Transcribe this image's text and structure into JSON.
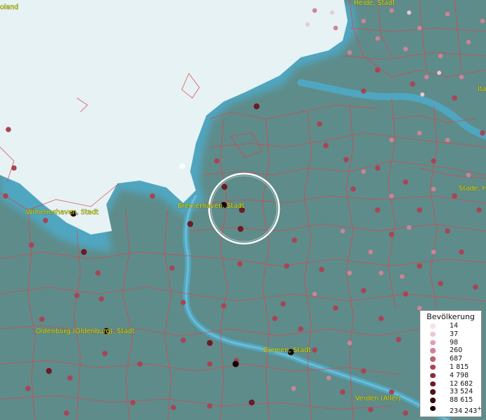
{
  "map": {
    "labels": {
      "top_left": "goland",
      "heide": "Heide, Stadt",
      "right_mid": "Stade, H",
      "right_top": "Ita",
      "bremerhaven": "Bremerhaven, Stadt",
      "wilhelmshaven": "Wilhelmshaven, Stadt",
      "oldenburg": "Oldenburg (Oldenburg), Stadt",
      "bremen": "Bremen, Stadt",
      "verden": "Verden (Aller)"
    },
    "colors": {
      "sea": "#e6f2f4",
      "land": "#5e8c8a",
      "river": "#4fa6c0",
      "border": "#e0404a",
      "label": "#e8e000",
      "highlight_ring": "#ffffff"
    },
    "selection": "ring"
  },
  "legend": {
    "title": "Bevölkerung",
    "items": [
      {
        "label": "14",
        "color": "#f6e3ea"
      },
      {
        "label": "37",
        "color": "#ecc7d2"
      },
      {
        "label": "98",
        "color": "#dda2b1"
      },
      {
        "label": "260",
        "color": "#cf8396"
      },
      {
        "label": "687",
        "color": "#bd6073"
      },
      {
        "label": "1 815",
        "color": "#a94454"
      },
      {
        "label": "4 798",
        "color": "#8c2c3a"
      },
      {
        "label": "12 682",
        "color": "#6e1a27"
      },
      {
        "label": "33 524",
        "color": "#521019"
      },
      {
        "label": "88 615",
        "color": "#360810"
      },
      {
        "label": "234 243",
        "color": "#1a0206"
      }
    ],
    "open_end_marker": "+"
  }
}
